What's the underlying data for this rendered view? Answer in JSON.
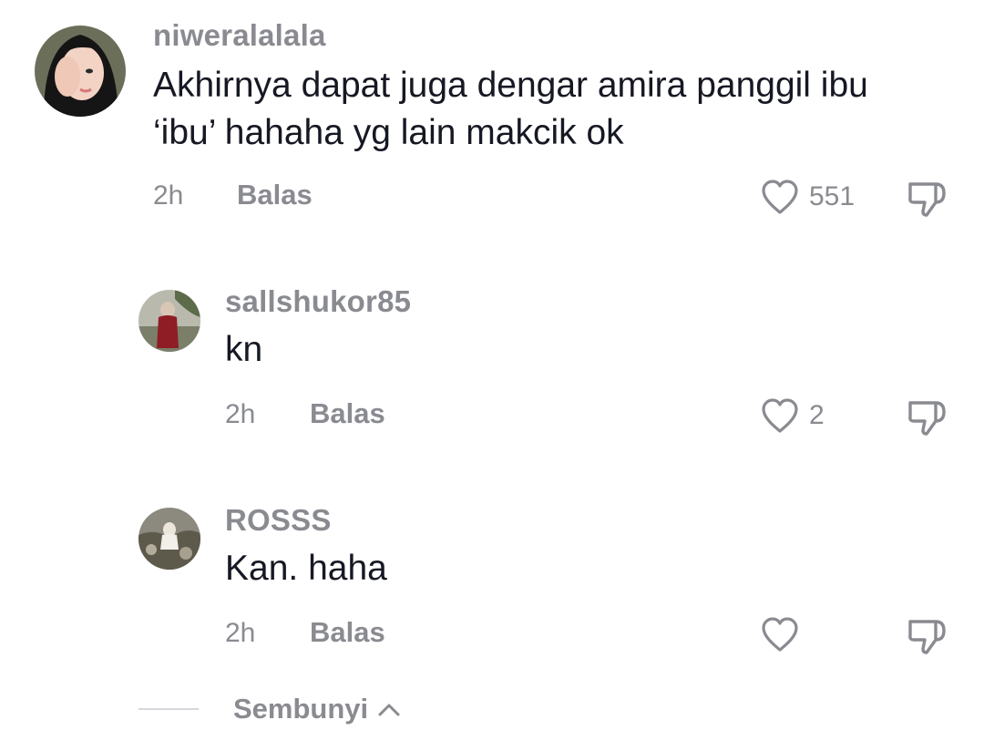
{
  "comments": [
    {
      "username": "niweralalala",
      "text": "Akhirnya dapat juga dengar amira panggil ibu\n‘ibu’ hahaha yg lain makcik ok",
      "time": "2h",
      "reply_label": "Balas",
      "likes": "551"
    },
    {
      "username": "sallshukor85",
      "text": "kn",
      "time": "2h",
      "reply_label": "Balas",
      "likes": "2"
    },
    {
      "username": "ROSSS",
      "text": "Kan. haha",
      "time": "2h",
      "reply_label": "Balas",
      "likes": ""
    }
  ],
  "hide_replies_label": "Sembunyi",
  "icons": {
    "like": "heart-outline-icon",
    "dislike": "thumbs-down-icon",
    "hide": "chevron-up-icon"
  },
  "colors": {
    "text": "#161823",
    "muted": "#8a8b91",
    "divider": "#d7d8db"
  }
}
